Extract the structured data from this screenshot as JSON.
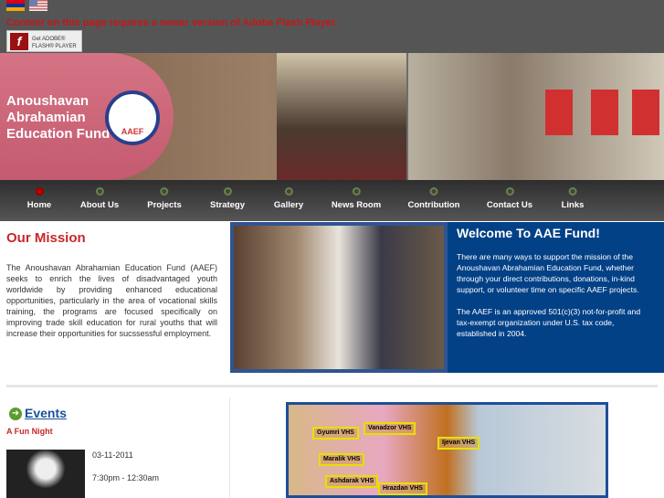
{
  "header": {
    "flash_message": "Content on this page requires a newer version of Adobe Flash Player.",
    "flash_button": {
      "line1": "Get ADOBE®",
      "line2": "FLASH® PLAYER"
    },
    "languages": [
      "Armenian",
      "English"
    ]
  },
  "banner": {
    "org_name": "Anoushavan Abrahamian Education Fund",
    "logo_text": "AAEF"
  },
  "nav": {
    "items": [
      {
        "label": "Home",
        "active": true
      },
      {
        "label": "About Us"
      },
      {
        "label": "Projects"
      },
      {
        "label": "Strategy"
      },
      {
        "label": "Gallery"
      },
      {
        "label": "News Room"
      },
      {
        "label": "Contribution"
      },
      {
        "label": "Contact Us"
      },
      {
        "label": "Links"
      }
    ]
  },
  "mission": {
    "title": "Our Mission",
    "text": "The Anoushavan Abrahamian Education Fund (AAEF) seeks to enrich the lives of disadvantaged youth worldwide by providing enhanced educational opportunities, particularly in the area of vocational skills training, the programs are focused specifically on improving trade skill education for rural youths that will increase their opportunities for sucssessful employment."
  },
  "welcome": {
    "title": "Welcome To AAE Fund!",
    "p1": "There are many ways to support the mission of the Anoushavan Abrahamian Education Fund, whether through your direct contributions, donations, in-kind support, or volunteer time on specific AAEF projects.",
    "p2": "The AAEF is an approved 501(c)(3) not-for-profit and tax-exempt organization under U.S. tax code, established in 2004."
  },
  "events": {
    "title": "Events",
    "name": "A Fun Night",
    "date": "03-11-2011",
    "time": "7:30pm - 12:30am"
  },
  "map": {
    "labels": [
      "Gyumri VHS",
      "Vanadzor VHS",
      "Ijevan VHS",
      "Maralik VHS",
      "Ashdarak VHS",
      "Hrazdan VHS"
    ]
  },
  "colors": {
    "accent_red": "#c62828",
    "panel_blue": "#034187",
    "nav_dark": "#2e2e2e"
  }
}
